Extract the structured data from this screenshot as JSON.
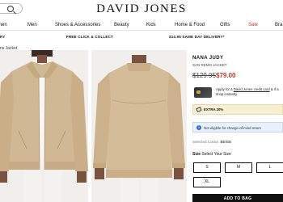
{
  "header": {
    "logo": "DAVID JONES",
    "nav": [
      {
        "label": "men"
      },
      {
        "label": "Men"
      },
      {
        "label": "Shoes & Accessories"
      },
      {
        "label": "Beauty"
      },
      {
        "label": "Kids"
      },
      {
        "label": "Home & Food"
      },
      {
        "label": "Gifts"
      },
      {
        "label": "Sale"
      },
      {
        "label": "Bra"
      }
    ]
  },
  "promo": {
    "left": "RY",
    "center": "FREE CLICK & COLLECT",
    "right": "$14.95 SAME DAY DELIVERY*"
  },
  "breadcrumb": "ns Jacket",
  "product": {
    "brand": "NANA JUDY",
    "name": "SAN REMO JACKET",
    "was_price": "$129.95",
    "price": "$79.00",
    "apply_text_1": "Apply for a ",
    "apply_link": "David Jones credit card",
    "apply_text_2": " & if a",
    "apply_text_3": "shop instantly.",
    "extra_offer": "EXTRA 20%",
    "notice": "Not eligible for change-of-mind return",
    "colour_key": "Selected Colour:",
    "colour_value": "BEIGE",
    "size_title": "Size",
    "size_prompt": "Select Your Size",
    "sizes": [
      "S",
      "M",
      "L",
      "XL"
    ],
    "add_to_bag": "ADD TO BAG"
  },
  "colors": {
    "sale": "#c0392b",
    "jacket": "#d1b895",
    "image_bg": "#f1efec"
  }
}
